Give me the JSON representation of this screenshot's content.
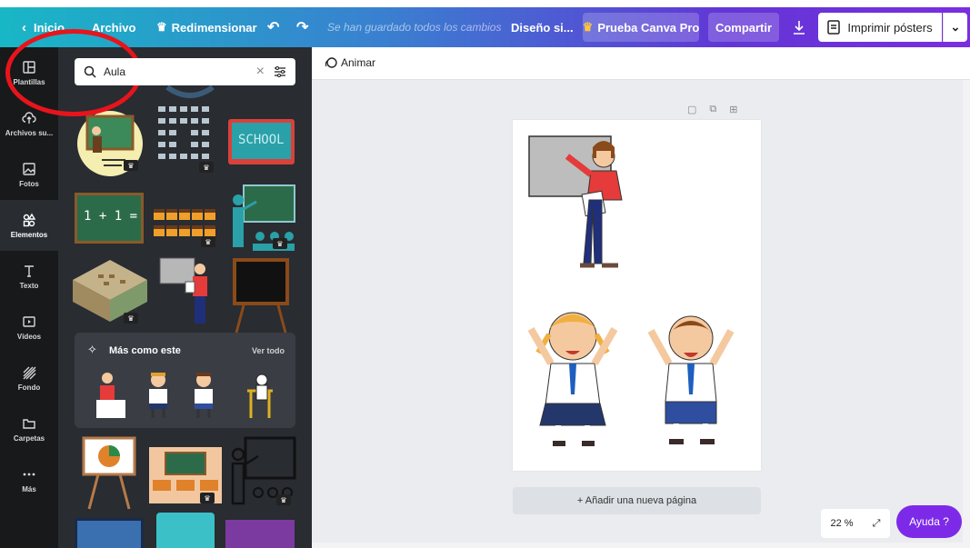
{
  "topbar": {
    "home": "Inicio",
    "file": "Archivo",
    "resize": "Redimensionar",
    "saved": "Se han guardado todos los cambios",
    "design": "Diseño si...",
    "pro": "Prueba Canva Pro",
    "share": "Compartir",
    "print": "Imprimir pósters"
  },
  "nav": {
    "items": [
      {
        "label": "Plantillas",
        "icon": "templates-icon"
      },
      {
        "label": "Archivos su...",
        "icon": "upload-icon"
      },
      {
        "label": "Fotos",
        "icon": "photo-icon"
      },
      {
        "label": "Elementos",
        "icon": "elements-icon"
      },
      {
        "label": "Texto",
        "icon": "text-icon"
      },
      {
        "label": "Vídeos",
        "icon": "video-icon"
      },
      {
        "label": "Fondo",
        "icon": "background-icon"
      },
      {
        "label": "Carpetas",
        "icon": "folder-icon"
      },
      {
        "label": "Más",
        "icon": "more-icon"
      }
    ]
  },
  "panel": {
    "search_value": "Aula",
    "school_sign": "SCHOOL",
    "math": "1 + 1 =",
    "more_like_this": "Más como este",
    "see_all": "Ver todo"
  },
  "canvas": {
    "animate": "Animar",
    "add_page": "+ Añadir una nueva página",
    "zoom": "22 %",
    "help": "Ayuda ?"
  },
  "colors": {
    "accent": "#7d2ae8",
    "sidebar": "#18191b",
    "panel": "#292c31",
    "annotation": "#e8141b"
  }
}
